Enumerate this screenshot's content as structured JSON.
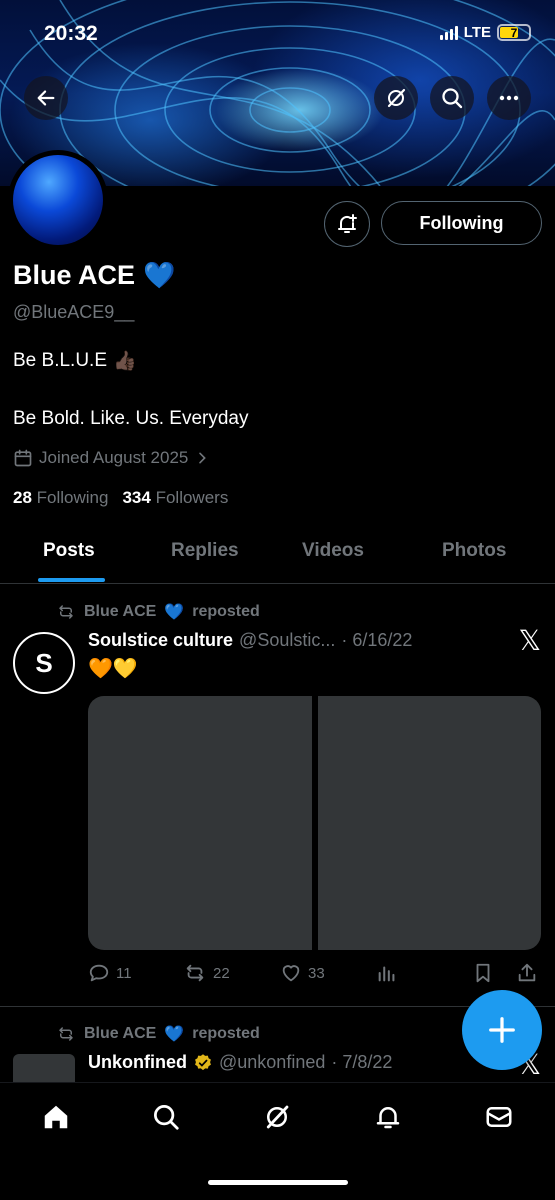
{
  "status_bar": {
    "time": "20:32",
    "network": "LTE",
    "battery": "7"
  },
  "profile": {
    "name": "Blue ACE",
    "name_emoji": "💙",
    "handle": "@BlueACE9__",
    "bio_line1": "Be B.L.U.E",
    "bio_line1_emoji": "👍🏿",
    "bio_line2": "Be Bold. Like. Us. Everyday",
    "joined": "Joined August 2025",
    "following_count": "28",
    "following_label": "Following",
    "followers_count": "334",
    "followers_label": "Followers",
    "follow_button": "Following"
  },
  "tabs": [
    "Posts",
    "Replies",
    "Videos",
    "Photos"
  ],
  "posts": [
    {
      "reposter": "Blue ACE",
      "reposter_emoji": "💙",
      "repost_label": "reposted",
      "author": "Soulstice culture",
      "handle": "@Soulstic...",
      "date": "· 6/16/22",
      "text": "🧡💛",
      "avatar_letter": "S",
      "replies": "11",
      "reposts": "22",
      "likes": "33"
    },
    {
      "reposter": "Blue ACE",
      "reposter_emoji": "💙",
      "repost_label": "reposted",
      "author": "Unkonfined",
      "handle": "@unkonfined",
      "date": "· 7/8/22"
    }
  ],
  "colors": {
    "accent": "#1d9bf0",
    "muted": "#71767b",
    "verified": "#e2b719"
  },
  "icons": [
    "back-arrow-icon",
    "grok-icon",
    "search-icon",
    "more-icon",
    "bell-plus-icon",
    "calendar-icon",
    "chevron-right-icon",
    "repost-icon",
    "x-logo-icon",
    "reply-icon",
    "like-icon",
    "views-icon",
    "bookmark-icon",
    "share-icon",
    "plus-icon",
    "home-icon",
    "notifications-icon",
    "messages-icon"
  ]
}
